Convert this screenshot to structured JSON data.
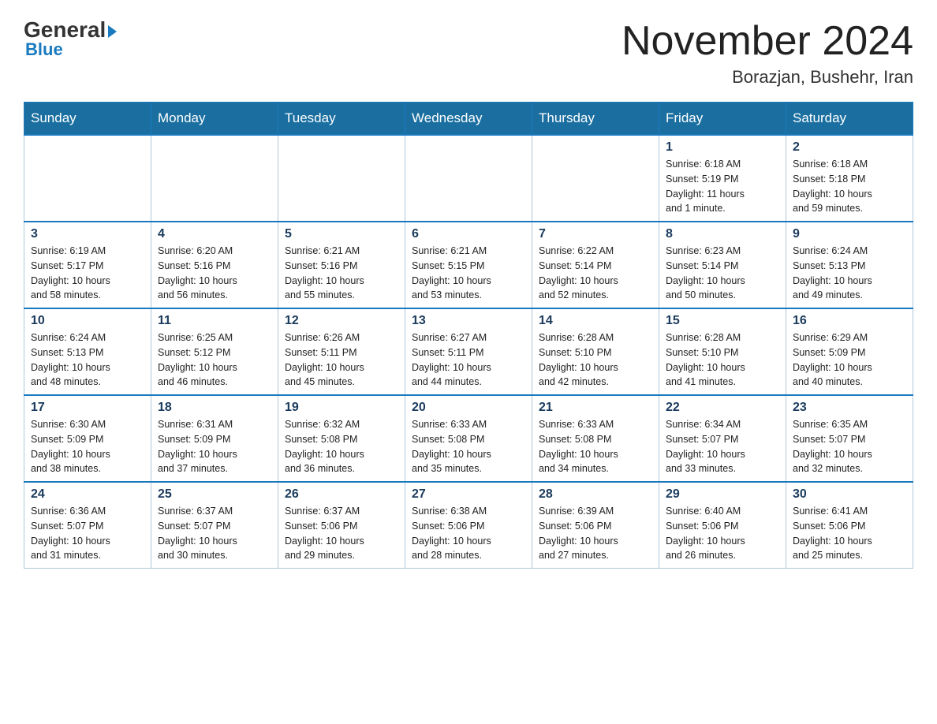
{
  "logo": {
    "general": "General",
    "blue": "Blue",
    "triangle": "▶"
  },
  "header": {
    "title": "November 2024",
    "subtitle": "Borazjan, Bushehr, Iran"
  },
  "weekdays": [
    "Sunday",
    "Monday",
    "Tuesday",
    "Wednesday",
    "Thursday",
    "Friday",
    "Saturday"
  ],
  "weeks": [
    [
      {
        "day": "",
        "info": ""
      },
      {
        "day": "",
        "info": ""
      },
      {
        "day": "",
        "info": ""
      },
      {
        "day": "",
        "info": ""
      },
      {
        "day": "",
        "info": ""
      },
      {
        "day": "1",
        "info": "Sunrise: 6:18 AM\nSunset: 5:19 PM\nDaylight: 11 hours\nand 1 minute."
      },
      {
        "day": "2",
        "info": "Sunrise: 6:18 AM\nSunset: 5:18 PM\nDaylight: 10 hours\nand 59 minutes."
      }
    ],
    [
      {
        "day": "3",
        "info": "Sunrise: 6:19 AM\nSunset: 5:17 PM\nDaylight: 10 hours\nand 58 minutes."
      },
      {
        "day": "4",
        "info": "Sunrise: 6:20 AM\nSunset: 5:16 PM\nDaylight: 10 hours\nand 56 minutes."
      },
      {
        "day": "5",
        "info": "Sunrise: 6:21 AM\nSunset: 5:16 PM\nDaylight: 10 hours\nand 55 minutes."
      },
      {
        "day": "6",
        "info": "Sunrise: 6:21 AM\nSunset: 5:15 PM\nDaylight: 10 hours\nand 53 minutes."
      },
      {
        "day": "7",
        "info": "Sunrise: 6:22 AM\nSunset: 5:14 PM\nDaylight: 10 hours\nand 52 minutes."
      },
      {
        "day": "8",
        "info": "Sunrise: 6:23 AM\nSunset: 5:14 PM\nDaylight: 10 hours\nand 50 minutes."
      },
      {
        "day": "9",
        "info": "Sunrise: 6:24 AM\nSunset: 5:13 PM\nDaylight: 10 hours\nand 49 minutes."
      }
    ],
    [
      {
        "day": "10",
        "info": "Sunrise: 6:24 AM\nSunset: 5:13 PM\nDaylight: 10 hours\nand 48 minutes."
      },
      {
        "day": "11",
        "info": "Sunrise: 6:25 AM\nSunset: 5:12 PM\nDaylight: 10 hours\nand 46 minutes."
      },
      {
        "day": "12",
        "info": "Sunrise: 6:26 AM\nSunset: 5:11 PM\nDaylight: 10 hours\nand 45 minutes."
      },
      {
        "day": "13",
        "info": "Sunrise: 6:27 AM\nSunset: 5:11 PM\nDaylight: 10 hours\nand 44 minutes."
      },
      {
        "day": "14",
        "info": "Sunrise: 6:28 AM\nSunset: 5:10 PM\nDaylight: 10 hours\nand 42 minutes."
      },
      {
        "day": "15",
        "info": "Sunrise: 6:28 AM\nSunset: 5:10 PM\nDaylight: 10 hours\nand 41 minutes."
      },
      {
        "day": "16",
        "info": "Sunrise: 6:29 AM\nSunset: 5:09 PM\nDaylight: 10 hours\nand 40 minutes."
      }
    ],
    [
      {
        "day": "17",
        "info": "Sunrise: 6:30 AM\nSunset: 5:09 PM\nDaylight: 10 hours\nand 38 minutes."
      },
      {
        "day": "18",
        "info": "Sunrise: 6:31 AM\nSunset: 5:09 PM\nDaylight: 10 hours\nand 37 minutes."
      },
      {
        "day": "19",
        "info": "Sunrise: 6:32 AM\nSunset: 5:08 PM\nDaylight: 10 hours\nand 36 minutes."
      },
      {
        "day": "20",
        "info": "Sunrise: 6:33 AM\nSunset: 5:08 PM\nDaylight: 10 hours\nand 35 minutes."
      },
      {
        "day": "21",
        "info": "Sunrise: 6:33 AM\nSunset: 5:08 PM\nDaylight: 10 hours\nand 34 minutes."
      },
      {
        "day": "22",
        "info": "Sunrise: 6:34 AM\nSunset: 5:07 PM\nDaylight: 10 hours\nand 33 minutes."
      },
      {
        "day": "23",
        "info": "Sunrise: 6:35 AM\nSunset: 5:07 PM\nDaylight: 10 hours\nand 32 minutes."
      }
    ],
    [
      {
        "day": "24",
        "info": "Sunrise: 6:36 AM\nSunset: 5:07 PM\nDaylight: 10 hours\nand 31 minutes."
      },
      {
        "day": "25",
        "info": "Sunrise: 6:37 AM\nSunset: 5:07 PM\nDaylight: 10 hours\nand 30 minutes."
      },
      {
        "day": "26",
        "info": "Sunrise: 6:37 AM\nSunset: 5:06 PM\nDaylight: 10 hours\nand 29 minutes."
      },
      {
        "day": "27",
        "info": "Sunrise: 6:38 AM\nSunset: 5:06 PM\nDaylight: 10 hours\nand 28 minutes."
      },
      {
        "day": "28",
        "info": "Sunrise: 6:39 AM\nSunset: 5:06 PM\nDaylight: 10 hours\nand 27 minutes."
      },
      {
        "day": "29",
        "info": "Sunrise: 6:40 AM\nSunset: 5:06 PM\nDaylight: 10 hours\nand 26 minutes."
      },
      {
        "day": "30",
        "info": "Sunrise: 6:41 AM\nSunset: 5:06 PM\nDaylight: 10 hours\nand 25 minutes."
      }
    ]
  ]
}
